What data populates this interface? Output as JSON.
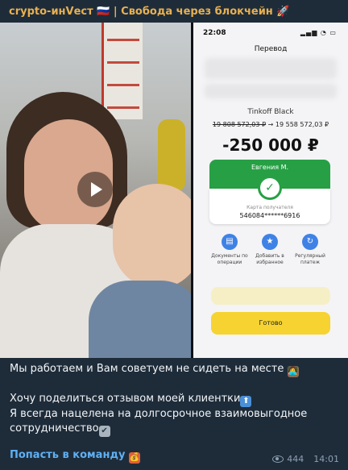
{
  "channel": {
    "title": "crypto-инVест 🇷🇺 | Свобода через блокчейн 🚀"
  },
  "phone": {
    "time": "22:08",
    "status": "▂▄▆ ◔ ▭",
    "title": "Перевод",
    "account_name": "Tinkoff Black",
    "balance_old": "19 808 572,03 ₽",
    "arrow": "→",
    "balance_new": "19 558 572,03 ₽",
    "amount": "-250 000 ₽",
    "recipient": "Евгения М.",
    "check_glyph": "✓",
    "card_label": "Карта получателя",
    "card_number": "546084******6916",
    "actions": [
      {
        "icon": "document-icon",
        "glyph": "▤",
        "label": "Документы по операции"
      },
      {
        "icon": "star-icon",
        "glyph": "★",
        "label": "Добавить в избранное"
      },
      {
        "icon": "repeat-icon",
        "glyph": "↻",
        "label": "Регулярный платеж"
      }
    ],
    "done_label": "Готово"
  },
  "message": {
    "line1": "Мы работаем и Вам советуем не сидеть на месте",
    "line2": "Хочу поделиться отзывом моей клиентки",
    "line3": "Я всегда нацелена на долгосрочное взаимовыгодное сотрудничество",
    "link": "Попасть в команду"
  },
  "meta": {
    "views": "444",
    "time": "14:01"
  },
  "colors": {
    "channel": "#e9b04f",
    "link": "#5fb0f3",
    "bubble": "#1e2c3a",
    "bank_green": "#27a045",
    "bank_yellow": "#f6d331"
  }
}
